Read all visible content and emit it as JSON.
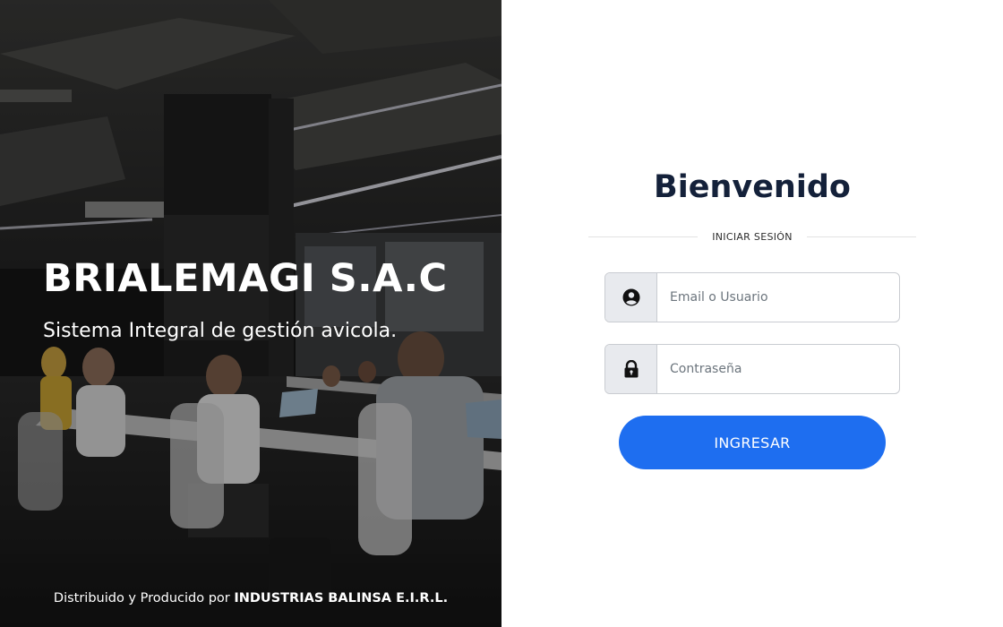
{
  "hero": {
    "company": "BRIALEMAGI S.A.C",
    "tagline": "Sistema Integral de gestión avicola.",
    "footer_prefix": "Distribuido y Producido por",
    "footer_company": "INDUSTRIAS BALINSA E.I.R.L."
  },
  "login": {
    "title": "Bienvenido",
    "divider_label": "INICIAR SESIÓN",
    "user_placeholder": "Email o Usuario",
    "user_icon": "user-circle-icon",
    "password_placeholder": "Contraseña",
    "password_icon": "lock-icon",
    "submit_label": "INGRESAR"
  },
  "colors": {
    "primary_button": "#1e6ef0",
    "title_text": "#14213a",
    "addon_bg": "#e8eaee"
  }
}
